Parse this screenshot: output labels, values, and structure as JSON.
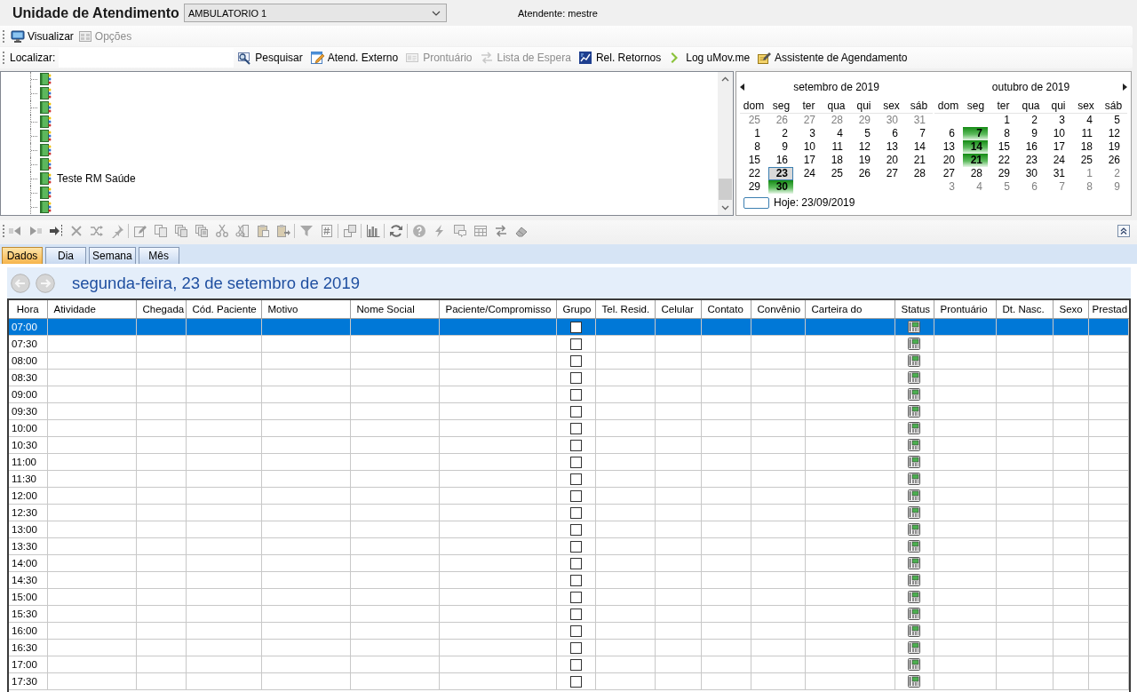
{
  "header": {
    "title": "Unidade de Atendimento",
    "unit_select": {
      "value": "AMBULATORIO 1"
    },
    "attendant": "Atendente: mestre"
  },
  "menu_toolbar": [
    {
      "label": "Visualizar",
      "disabled": false
    },
    {
      "label": "Opções",
      "disabled": true
    }
  ],
  "search_toolbar": {
    "label": "Localizar:",
    "actions": [
      {
        "label": "Pesquisar",
        "disabled": false
      },
      {
        "label": "Atend. Externo",
        "disabled": false
      },
      {
        "label": "Prontuário",
        "disabled": true
      },
      {
        "label": "Lista de Espera",
        "disabled": true
      },
      {
        "label": "Rel. Retornos",
        "disabled": false
      },
      {
        "label": "Log uMov.me",
        "disabled": false
      },
      {
        "label": "Assistente de Agendamento",
        "disabled": false
      }
    ]
  },
  "tree": {
    "items": [
      {
        "selected": false
      },
      {
        "selected": false
      },
      {
        "selected": false
      },
      {
        "selected": false
      },
      {
        "selected": false
      },
      {
        "selected": false
      },
      {
        "selected": false
      },
      {
        "label": "Teste RM Saúde",
        "selected": false
      },
      {
        "selected": false
      },
      {
        "selected": false
      }
    ]
  },
  "calendar": {
    "months": [
      {
        "title": "setembro de 2019",
        "weekdays": [
          "dom",
          "seg",
          "ter",
          "qua",
          "qui",
          "sex",
          "sáb"
        ],
        "weeks": [
          [
            {
              "day": "25",
              "other_month": true,
              "busy": false,
              "selected": false
            },
            {
              "day": "26",
              "other_month": true,
              "busy": false,
              "selected": false
            },
            {
              "day": "27",
              "other_month": true,
              "busy": false,
              "selected": false
            },
            {
              "day": "28",
              "other_month": true,
              "busy": false,
              "selected": false
            },
            {
              "day": "29",
              "other_month": true,
              "busy": false,
              "selected": false
            },
            {
              "day": "30",
              "other_month": true,
              "busy": false,
              "selected": false
            },
            {
              "day": "31",
              "other_month": true,
              "busy": false,
              "selected": false
            }
          ],
          [
            {
              "day": "1",
              "other_month": false,
              "busy": false,
              "selected": false
            },
            {
              "day": "2",
              "other_month": false,
              "busy": false,
              "selected": false
            },
            {
              "day": "3",
              "other_month": false,
              "busy": false,
              "selected": false
            },
            {
              "day": "4",
              "other_month": false,
              "busy": false,
              "selected": false
            },
            {
              "day": "5",
              "other_month": false,
              "busy": false,
              "selected": false
            },
            {
              "day": "6",
              "other_month": false,
              "busy": false,
              "selected": false
            },
            {
              "day": "7",
              "other_month": false,
              "busy": false,
              "selected": false
            }
          ],
          [
            {
              "day": "8",
              "other_month": false,
              "busy": false,
              "selected": false
            },
            {
              "day": "9",
              "other_month": false,
              "busy": false,
              "selected": false
            },
            {
              "day": "10",
              "other_month": false,
              "busy": false,
              "selected": false
            },
            {
              "day": "11",
              "other_month": false,
              "busy": false,
              "selected": false
            },
            {
              "day": "12",
              "other_month": false,
              "busy": false,
              "selected": false
            },
            {
              "day": "13",
              "other_month": false,
              "busy": false,
              "selected": false
            },
            {
              "day": "14",
              "other_month": false,
              "busy": false,
              "selected": false
            }
          ],
          [
            {
              "day": "15",
              "other_month": false,
              "busy": false,
              "selected": false
            },
            {
              "day": "16",
              "other_month": false,
              "busy": false,
              "selected": false
            },
            {
              "day": "17",
              "other_month": false,
              "busy": false,
              "selected": false
            },
            {
              "day": "18",
              "other_month": false,
              "busy": false,
              "selected": false
            },
            {
              "day": "19",
              "other_month": false,
              "busy": false,
              "selected": false
            },
            {
              "day": "20",
              "other_month": false,
              "busy": false,
              "selected": false
            },
            {
              "day": "21",
              "other_month": false,
              "busy": false,
              "selected": false
            }
          ],
          [
            {
              "day": "22",
              "other_month": false,
              "busy": false,
              "selected": false
            },
            {
              "day": "23",
              "other_month": false,
              "busy": false,
              "selected": true
            },
            {
              "day": "24",
              "other_month": false,
              "busy": false,
              "selected": false
            },
            {
              "day": "25",
              "other_month": false,
              "busy": false,
              "selected": false
            },
            {
              "day": "26",
              "other_month": false,
              "busy": false,
              "selected": false
            },
            {
              "day": "27",
              "other_month": false,
              "busy": false,
              "selected": false
            },
            {
              "day": "28",
              "other_month": false,
              "busy": false,
              "selected": false
            }
          ],
          [
            {
              "day": "29",
              "other_month": false,
              "busy": false,
              "selected": false
            },
            {
              "day": "30",
              "other_month": false,
              "busy": true,
              "selected": false
            }
          ]
        ]
      },
      {
        "title": "outubro de 2019",
        "weekdays": [
          "dom",
          "seg",
          "ter",
          "qua",
          "qui",
          "sex",
          "sáb"
        ],
        "weeks": [
          [
            {
              "day": "1",
              "other_month": false,
              "busy": false,
              "selected": false
            },
            {
              "day": "2",
              "other_month": false,
              "busy": false,
              "selected": false
            },
            {
              "day": "3",
              "other_month": false,
              "busy": false,
              "selected": false
            },
            {
              "day": "4",
              "other_month": false,
              "busy": false,
              "selected": false
            },
            {
              "day": "5",
              "other_month": false,
              "busy": false,
              "selected": false
            }
          ],
          [
            {
              "day": "6",
              "other_month": false,
              "busy": false,
              "selected": false
            },
            {
              "day": "7",
              "other_month": false,
              "busy": true,
              "selected": false
            },
            {
              "day": "8",
              "other_month": false,
              "busy": false,
              "selected": false
            },
            {
              "day": "9",
              "other_month": false,
              "busy": false,
              "selected": false
            },
            {
              "day": "10",
              "other_month": false,
              "busy": false,
              "selected": false
            },
            {
              "day": "11",
              "other_month": false,
              "busy": false,
              "selected": false
            },
            {
              "day": "12",
              "other_month": false,
              "busy": false,
              "selected": false
            }
          ],
          [
            {
              "day": "13",
              "other_month": false,
              "busy": false,
              "selected": false
            },
            {
              "day": "14",
              "other_month": false,
              "busy": true,
              "selected": false
            },
            {
              "day": "15",
              "other_month": false,
              "busy": false,
              "selected": false
            },
            {
              "day": "16",
              "other_month": false,
              "busy": false,
              "selected": false
            },
            {
              "day": "17",
              "other_month": false,
              "busy": false,
              "selected": false
            },
            {
              "day": "18",
              "other_month": false,
              "busy": false,
              "selected": false
            },
            {
              "day": "19",
              "other_month": false,
              "busy": false,
              "selected": false
            }
          ],
          [
            {
              "day": "20",
              "other_month": false,
              "busy": false,
              "selected": false
            },
            {
              "day": "21",
              "other_month": false,
              "busy": true,
              "selected": false
            },
            {
              "day": "22",
              "other_month": false,
              "busy": false,
              "selected": false
            },
            {
              "day": "23",
              "other_month": false,
              "busy": false,
              "selected": false
            },
            {
              "day": "24",
              "other_month": false,
              "busy": false,
              "selected": false
            },
            {
              "day": "25",
              "other_month": false,
              "busy": false,
              "selected": false
            },
            {
              "day": "26",
              "other_month": false,
              "busy": false,
              "selected": false
            }
          ],
          [
            {
              "day": "27",
              "other_month": false,
              "busy": false,
              "selected": false
            },
            {
              "day": "28",
              "other_month": false,
              "busy": false,
              "selected": false
            },
            {
              "day": "29",
              "other_month": false,
              "busy": false,
              "selected": false
            },
            {
              "day": "30",
              "other_month": false,
              "busy": false,
              "selected": false
            },
            {
              "day": "31",
              "other_month": false,
              "busy": false,
              "selected": false
            },
            {
              "day": "1",
              "other_month": true,
              "busy": false,
              "selected": false
            },
            {
              "day": "2",
              "other_month": true,
              "busy": false,
              "selected": false
            }
          ],
          [
            {
              "day": "3",
              "other_month": true,
              "busy": false,
              "selected": false
            },
            {
              "day": "4",
              "other_month": true,
              "busy": false,
              "selected": false
            },
            {
              "day": "5",
              "other_month": true,
              "busy": false,
              "selected": false
            },
            {
              "day": "6",
              "other_month": true,
              "busy": false,
              "selected": false
            },
            {
              "day": "7",
              "other_month": true,
              "busy": false,
              "selected": false
            },
            {
              "day": "8",
              "other_month": true,
              "busy": false,
              "selected": false
            },
            {
              "day": "9",
              "other_month": true,
              "busy": false,
              "selected": false
            }
          ]
        ]
      }
    ],
    "today": "Hoje: 23/09/2019"
  },
  "view_tabs": [
    {
      "label": "Dados",
      "selected": true
    },
    {
      "label": "Dia",
      "selected": false
    },
    {
      "label": "Semana",
      "selected": false
    },
    {
      "label": "Mês",
      "selected": false
    }
  ],
  "day_header": {
    "title": "segunda-feira, 23 de setembro de 2019"
  },
  "schedule": {
    "columns": [
      {
        "label": "Hora",
        "kind": "time"
      },
      {
        "label": "Atividade",
        "kind": "text"
      },
      {
        "label": "Chegada",
        "kind": "text"
      },
      {
        "label": "Cód. Paciente",
        "kind": "text"
      },
      {
        "label": "Motivo",
        "kind": "text"
      },
      {
        "label": "Nome Social",
        "kind": "text"
      },
      {
        "label": "Paciente/Compromisso",
        "kind": "text"
      },
      {
        "label": "Grupo",
        "kind": "checkbox"
      },
      {
        "label": "Tel. Resid.",
        "kind": "text"
      },
      {
        "label": "Celular",
        "kind": "text"
      },
      {
        "label": "Contato",
        "kind": "text"
      },
      {
        "label": "Convênio",
        "kind": "text"
      },
      {
        "label": "Carteira do",
        "kind": "text"
      },
      {
        "label": "Status",
        "kind": "status"
      },
      {
        "label": "Prontuário",
        "kind": "text"
      },
      {
        "label": "Dt. Nasc.",
        "kind": "text"
      },
      {
        "label": "Sexo",
        "kind": "text"
      },
      {
        "label": "Prestad",
        "kind": "text"
      }
    ],
    "rows": [
      {
        "hora": "07:00",
        "grupo": false,
        "selected": true
      },
      {
        "hora": "07:30",
        "grupo": false,
        "selected": false
      },
      {
        "hora": "08:00",
        "grupo": false,
        "selected": false
      },
      {
        "hora": "08:30",
        "grupo": false,
        "selected": false
      },
      {
        "hora": "09:00",
        "grupo": false,
        "selected": false
      },
      {
        "hora": "09:30",
        "grupo": false,
        "selected": false
      },
      {
        "hora": "10:00",
        "grupo": false,
        "selected": false
      },
      {
        "hora": "10:30",
        "grupo": false,
        "selected": false
      },
      {
        "hora": "11:00",
        "grupo": false,
        "selected": false
      },
      {
        "hora": "11:30",
        "grupo": false,
        "selected": false
      },
      {
        "hora": "12:00",
        "grupo": false,
        "selected": false
      },
      {
        "hora": "12:30",
        "grupo": false,
        "selected": false
      },
      {
        "hora": "13:00",
        "grupo": false,
        "selected": false
      },
      {
        "hora": "13:30",
        "grupo": false,
        "selected": false
      },
      {
        "hora": "14:00",
        "grupo": false,
        "selected": false
      },
      {
        "hora": "14:30",
        "grupo": false,
        "selected": false
      },
      {
        "hora": "15:00",
        "grupo": false,
        "selected": false
      },
      {
        "hora": "15:30",
        "grupo": false,
        "selected": false
      },
      {
        "hora": "16:00",
        "grupo": false,
        "selected": false
      },
      {
        "hora": "16:30",
        "grupo": false,
        "selected": false
      },
      {
        "hora": "17:00",
        "grupo": false,
        "selected": false
      },
      {
        "hora": "17:30",
        "grupo": false,
        "selected": false
      }
    ]
  }
}
